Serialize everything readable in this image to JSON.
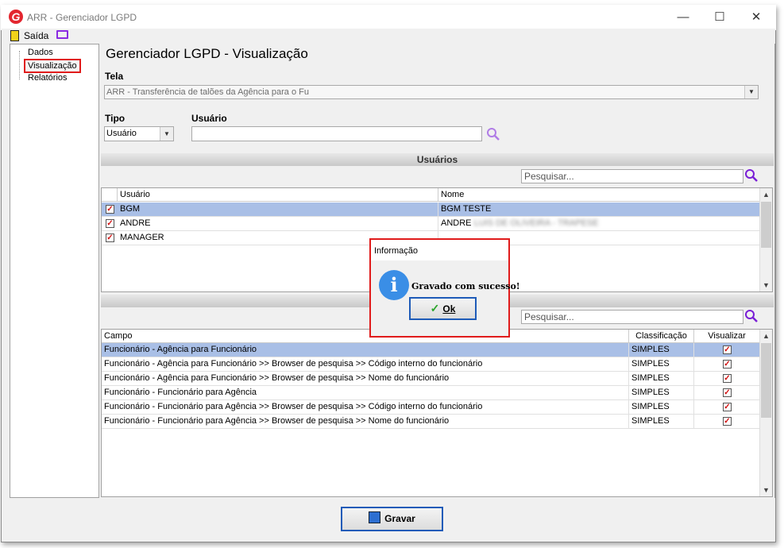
{
  "window": {
    "title": "ARR - Gerenciador LGPD",
    "logo_letter": "G",
    "minimize": "—",
    "maximize": "☐",
    "close": "✕"
  },
  "menubar": {
    "exit_label": "Saída"
  },
  "tree": {
    "items": [
      {
        "label": "Dados"
      },
      {
        "label": "Visualização"
      },
      {
        "label": "Relatórios"
      }
    ]
  },
  "page": {
    "title": "Gerenciador LGPD - Visualização",
    "tela_label": "Tela",
    "tela_value": "ARR - Transferência de talões da Agência para o Fu",
    "tipo_label": "Tipo",
    "tipo_value": "Usuário",
    "usuario_label": "Usuário",
    "usuario_value": ""
  },
  "users_section": {
    "title": "Usuários",
    "search_placeholder": "Pesquisar...",
    "columns": [
      "Usuário",
      "Nome"
    ],
    "rows": [
      {
        "checked": true,
        "user": "BGM",
        "name": "BGM TESTE",
        "selected": true
      },
      {
        "checked": true,
        "user": "ANDRE",
        "name": "ANDRE",
        "name_redacted": "LUIS DE OLIVEIRA - TRAPESE",
        "selected": false
      },
      {
        "checked": true,
        "user": "MANAGER",
        "name": "",
        "selected": false
      }
    ]
  },
  "fields_section": {
    "search_placeholder": "Pesquisar...",
    "columns": [
      "Campo",
      "Classificação",
      "Visualizar"
    ],
    "rows": [
      {
        "campo": "Funcionário - Agência para Funcionário",
        "classificacao": "SIMPLES",
        "visualizar": true,
        "selected": true
      },
      {
        "campo": "Funcionário - Agência para Funcionário >> Browser de pesquisa >> Código interno do funcionário",
        "classificacao": "SIMPLES",
        "visualizar": true,
        "selected": false
      },
      {
        "campo": "Funcionário - Agência para Funcionário >> Browser de pesquisa >> Nome do funcionário",
        "classificacao": "SIMPLES",
        "visualizar": true,
        "selected": false
      },
      {
        "campo": "Funcionário - Funcionário para Agência",
        "classificacao": "SIMPLES",
        "visualizar": true,
        "selected": false
      },
      {
        "campo": "Funcionário - Funcionário para Agência >> Browser de pesquisa >> Código interno do funcionário",
        "classificacao": "SIMPLES",
        "visualizar": true,
        "selected": false
      },
      {
        "campo": "Funcionário - Funcionário para Agência >> Browser de pesquisa >> Nome do funcionário",
        "classificacao": "SIMPLES",
        "visualizar": true,
        "selected": false
      }
    ]
  },
  "dialog": {
    "title": "Informação",
    "message": "Gravado com sucesso!",
    "ok_label": "Ok",
    "icon_glyph": "i"
  },
  "footer": {
    "save_label": "Gravar"
  },
  "colors": {
    "highlight": "#e01b1b",
    "selection": "#a9bfe6",
    "search_icon": "#8a2be2",
    "info": "#3a8ee6"
  }
}
